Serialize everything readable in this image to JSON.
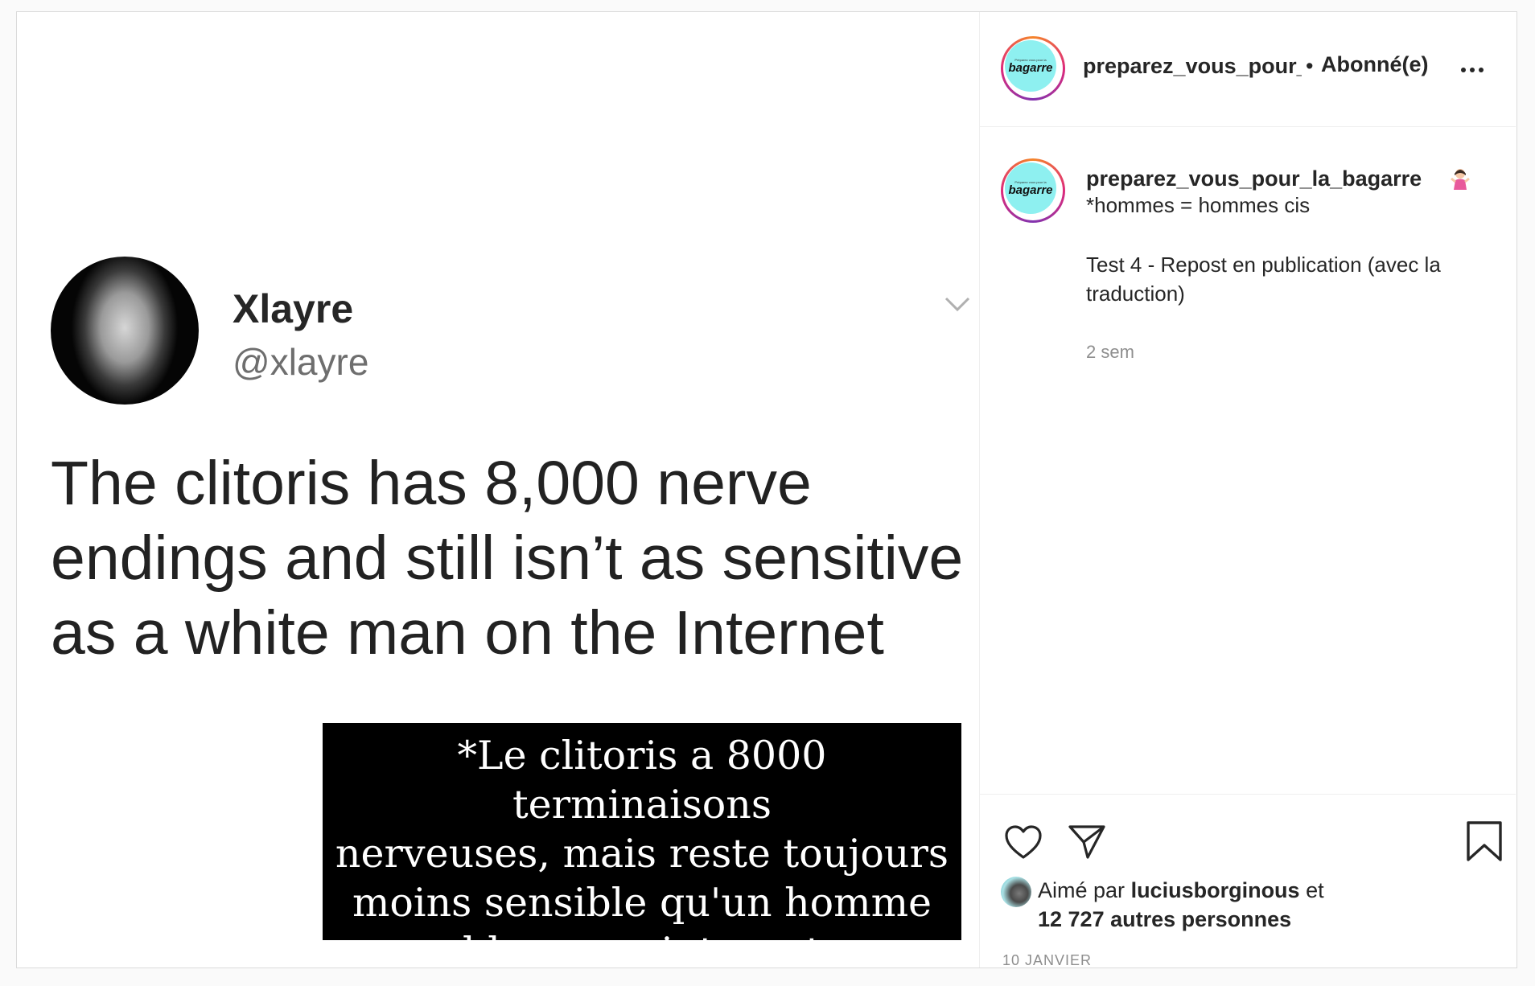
{
  "post_image": {
    "tweet": {
      "display_name": "Xlayre",
      "handle": "@xlayre",
      "text": "The clitoris has 8,000 nerve endings and still isn’t as sensitive as a white man on the Internet"
    },
    "translation": {
      "lines": [
        "*Le clitoris a 8000 terminaisons",
        "nerveuses, mais reste toujours",
        "moins sensible qu'un homme",
        "blanc sur internet"
      ]
    }
  },
  "header": {
    "avatar_text_small": "Préparez vous pour la",
    "avatar_text_big": "bagarre",
    "username": "preparez_vous_pour_la_bagarre",
    "separator": "•",
    "follow_status": "Abonné(e)"
  },
  "caption": {
    "username": "preparez_vous_pour_la_bagarre",
    "line1": "*hommes = hommes cis",
    "line2": "Test 4 - Repost en publication (avec la",
    "line3": "traduction)",
    "time": "2 sem"
  },
  "likes": {
    "prefix": "Aimé par",
    "user": "luciusborginous",
    "suffix": "et",
    "count_text": "12 727 autres personnes"
  },
  "date": "10 JANVIER",
  "icons": [
    "chevron-down-icon",
    "more-options-icon",
    "heart-icon",
    "share-icon",
    "bookmark-icon",
    "woman-shrugging-emoji-icon"
  ],
  "colors": {
    "ring_gradient": [
      "#f58529",
      "#dd2a7b",
      "#8134af"
    ],
    "avatar_bg": "#8ef0f0",
    "translation_bg": "#000000",
    "muted_text": "#8e8e8e"
  }
}
